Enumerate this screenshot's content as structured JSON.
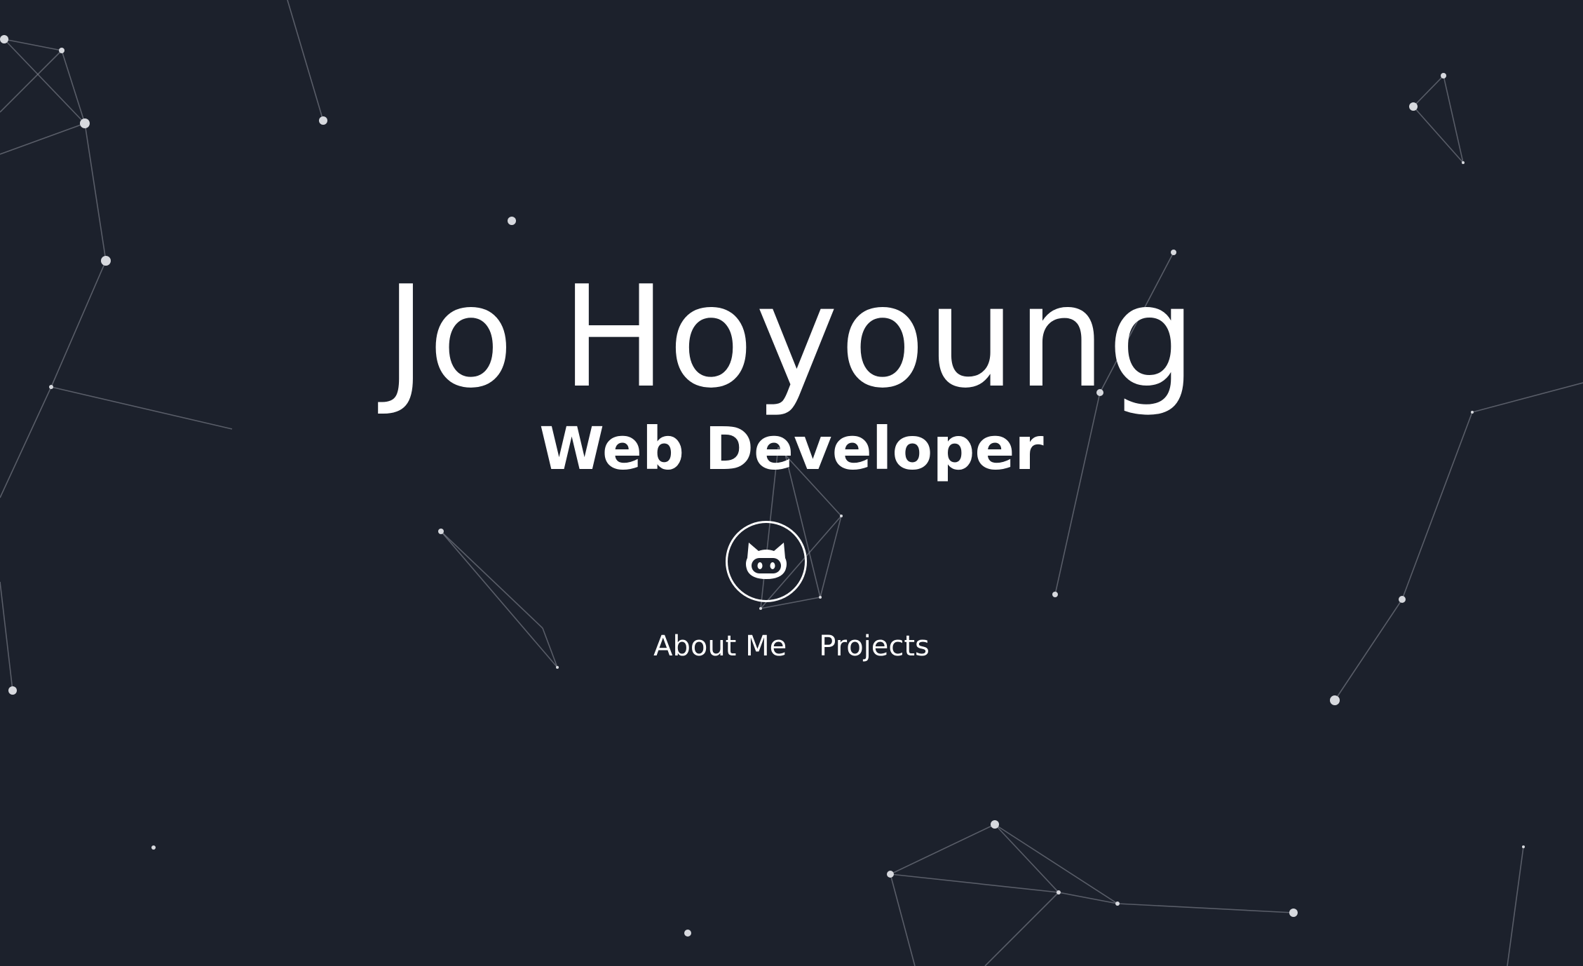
{
  "hero": {
    "name": "Jo Hoyoung",
    "role": "Web Developer"
  },
  "social": {
    "github_icon": "github-octocat-icon"
  },
  "nav": {
    "items": [
      {
        "label": "About Me"
      },
      {
        "label": "Projects"
      }
    ]
  },
  "theme": {
    "background": "#1c212c",
    "text": "#ffffff",
    "particle": "#d7d9de",
    "link_line": "#8b8f99"
  }
}
